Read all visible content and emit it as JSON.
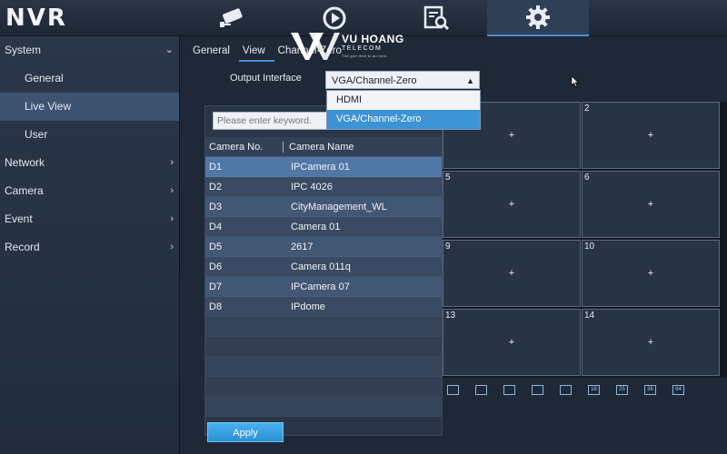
{
  "app": {
    "logo": "NVR"
  },
  "topnav": [
    {
      "name": "camera-icon"
    },
    {
      "name": "playback-icon"
    },
    {
      "name": "search-file-icon"
    },
    {
      "name": "gear-icon",
      "active": true
    }
  ],
  "sidebar": {
    "items": [
      {
        "label": "System",
        "chevron": "⌄"
      },
      {
        "label": "General"
      },
      {
        "label": "Live View",
        "active": true
      },
      {
        "label": "User"
      },
      {
        "label": "Network",
        "chevron": "›"
      },
      {
        "label": "Camera",
        "chevron": "›"
      },
      {
        "label": "Event",
        "chevron": "›"
      },
      {
        "label": "Record",
        "chevron": "›"
      }
    ]
  },
  "tabs": [
    {
      "label": "General"
    },
    {
      "label": "View",
      "active": true
    },
    {
      "label": "Channel-Zero"
    }
  ],
  "watermark": {
    "line1": "VU HOANG",
    "line2": "TELECOM",
    "line3": "Thế giới thiết bị an ninh"
  },
  "output_interface": {
    "label": "Output Interface",
    "value": "VGA/Channel-Zero",
    "options": [
      "HDMI",
      "VGA/Channel-Zero"
    ],
    "selected_index": 1
  },
  "search": {
    "placeholder": "Please enter keyword."
  },
  "camera_table": {
    "headers": [
      "Camera No.",
      "Camera Name"
    ],
    "rows": [
      {
        "no": "D1",
        "name": "IPCamera 01"
      },
      {
        "no": "D2",
        "name": "IPC 4026"
      },
      {
        "no": "D3",
        "name": "CityManagement_WL"
      },
      {
        "no": "D4",
        "name": "Camera 01"
      },
      {
        "no": "D5",
        "name": "2617"
      },
      {
        "no": "D6",
        "name": "Camera 011q"
      },
      {
        "no": "D7",
        "name": "IPCamera 07"
      },
      {
        "no": "D8",
        "name": "IPdome"
      }
    ]
  },
  "grid": {
    "cells": [
      {
        "num": "",
        "plus": "+"
      },
      {
        "num": "2",
        "plus": "+"
      },
      {
        "num": "5",
        "plus": "+"
      },
      {
        "num": "6",
        "plus": "+"
      },
      {
        "num": "9",
        "plus": "+"
      },
      {
        "num": "10",
        "plus": "+"
      },
      {
        "num": "13",
        "plus": "+"
      },
      {
        "num": "14",
        "plus": "+"
      }
    ]
  },
  "layouts": [
    "1",
    "4",
    "6",
    "8",
    "9",
    "16",
    "25",
    "36",
    "64"
  ],
  "apply_label": "Apply",
  "colors": {
    "accent": "#3c93d6",
    "apply": "#2c8fd4",
    "selected_row": "#5177a6"
  }
}
